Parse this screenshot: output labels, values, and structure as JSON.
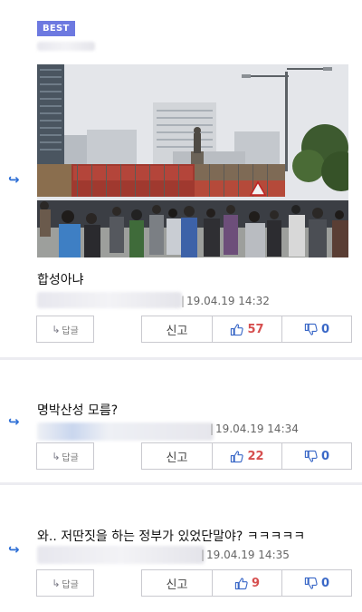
{
  "comments": [
    {
      "badge": "BEST",
      "text": "합성아냐",
      "time": "19.04.19 14:32",
      "reply_label": "답글",
      "report_label": "신고",
      "up_count": "57",
      "down_count": "0",
      "has_photo": true
    },
    {
      "text": "명박산성 모름?",
      "time": "19.04.19 14:34",
      "reply_label": "답글",
      "report_label": "신고",
      "up_count": "22",
      "down_count": "0"
    },
    {
      "text": "와.. 저딴짓을 하는 정부가 있었단말야? ㅋㅋㅋㅋㅋ",
      "time": "19.04.19 14:35",
      "reply_label": "답글",
      "report_label": "신고",
      "up_count": "9",
      "down_count": "0"
    }
  ],
  "icons": {
    "reply_arrow": "reply-arrow-icon",
    "thumbs_up": "thumbs-up-icon",
    "thumbs_down": "thumbs-down-icon"
  },
  "colors": {
    "badge": "#6d79e0",
    "reply_arrow": "#2e6fd6",
    "up_count": "#d64f4f",
    "down_count": "#3a68c7"
  }
}
